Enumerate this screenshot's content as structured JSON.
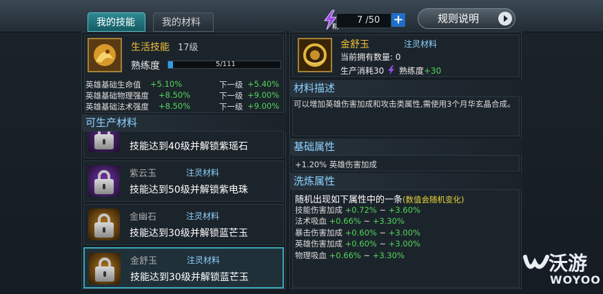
{
  "tabs": {
    "skills": "我的技能",
    "materials": "我的材料"
  },
  "energy": {
    "value": "7 /50",
    "plus": "+",
    "icon": "purple-lightning-icon",
    "icon_text": "精"
  },
  "rules": {
    "label": "规则说明"
  },
  "skill": {
    "title": "生活技能",
    "level": "17级",
    "proficiency_label": "熟练度",
    "proficiency_text": "5/111",
    "proficiency_fraction": 0.045,
    "stats": [
      {
        "name": "英雄基础生命值",
        "current": "+5.10%",
        "next_label": "下一级",
        "next": "+5.40%"
      },
      {
        "name": "英雄基础物理强度",
        "current": "+8.50%",
        "next_label": "下一级",
        "next": "+9.00%"
      },
      {
        "name": "英雄基础法术强度",
        "current": "+8.50%",
        "next_label": "下一级",
        "next": "+9.00%"
      }
    ]
  },
  "producible": {
    "header": "可生产材料",
    "items": [
      {
        "name": "",
        "tag": "",
        "desc": "技能达到40级并解锁紫瑶石",
        "color": "purple"
      },
      {
        "name": "紫云玉",
        "tag": "注灵材料",
        "desc": "技能达到50级并解锁紫电珠",
        "color": "purple"
      },
      {
        "name": "金幽石",
        "tag": "注灵材料",
        "desc": "技能达到30级并解锁蓝芒玉",
        "color": "gold"
      },
      {
        "name": "金舒玉",
        "tag": "注灵材料",
        "desc": "技能达到30级并解锁蓝芒玉",
        "color": "gold"
      }
    ]
  },
  "material": {
    "title": "金舒玉",
    "tag": "注灵材料",
    "owned": "当前拥有数量: 0",
    "cost_prefix": "生产消耗30",
    "cost_suffix_label": "熟练度",
    "cost_suffix_value": "+30",
    "desc_header": "材料描述",
    "desc": "可以增加英雄伤害加成和攻击类属性,需使用3个月华玄晶合成。",
    "basic_header": "基础属性",
    "basic": "+1.20% 英雄伤害加成",
    "refine_header": "洗炼属性",
    "refine_head": "随机出现如下属性中的一条",
    "refine_note": "(数值会随机变化)",
    "refine": [
      {
        "name": "技能伤害加成",
        "low": "+0.72%",
        "sep": "~",
        "high": "+3.60%"
      },
      {
        "name": "法术吸血",
        "low": "+0.66%",
        "sep": "~",
        "high": "+3.30%"
      },
      {
        "name": "暴击伤害加成",
        "low": "+0.60%",
        "sep": "~",
        "high": "+3.00%"
      },
      {
        "name": "英雄伤害加成",
        "low": "+0.60%",
        "sep": "~",
        "high": "+3.00%"
      },
      {
        "name": "物理吸血",
        "low": "+0.66%",
        "sep": "~",
        "high": "+3.30%"
      }
    ]
  },
  "watermark": {
    "cn": "沃游",
    "en": "WOYOO"
  }
}
